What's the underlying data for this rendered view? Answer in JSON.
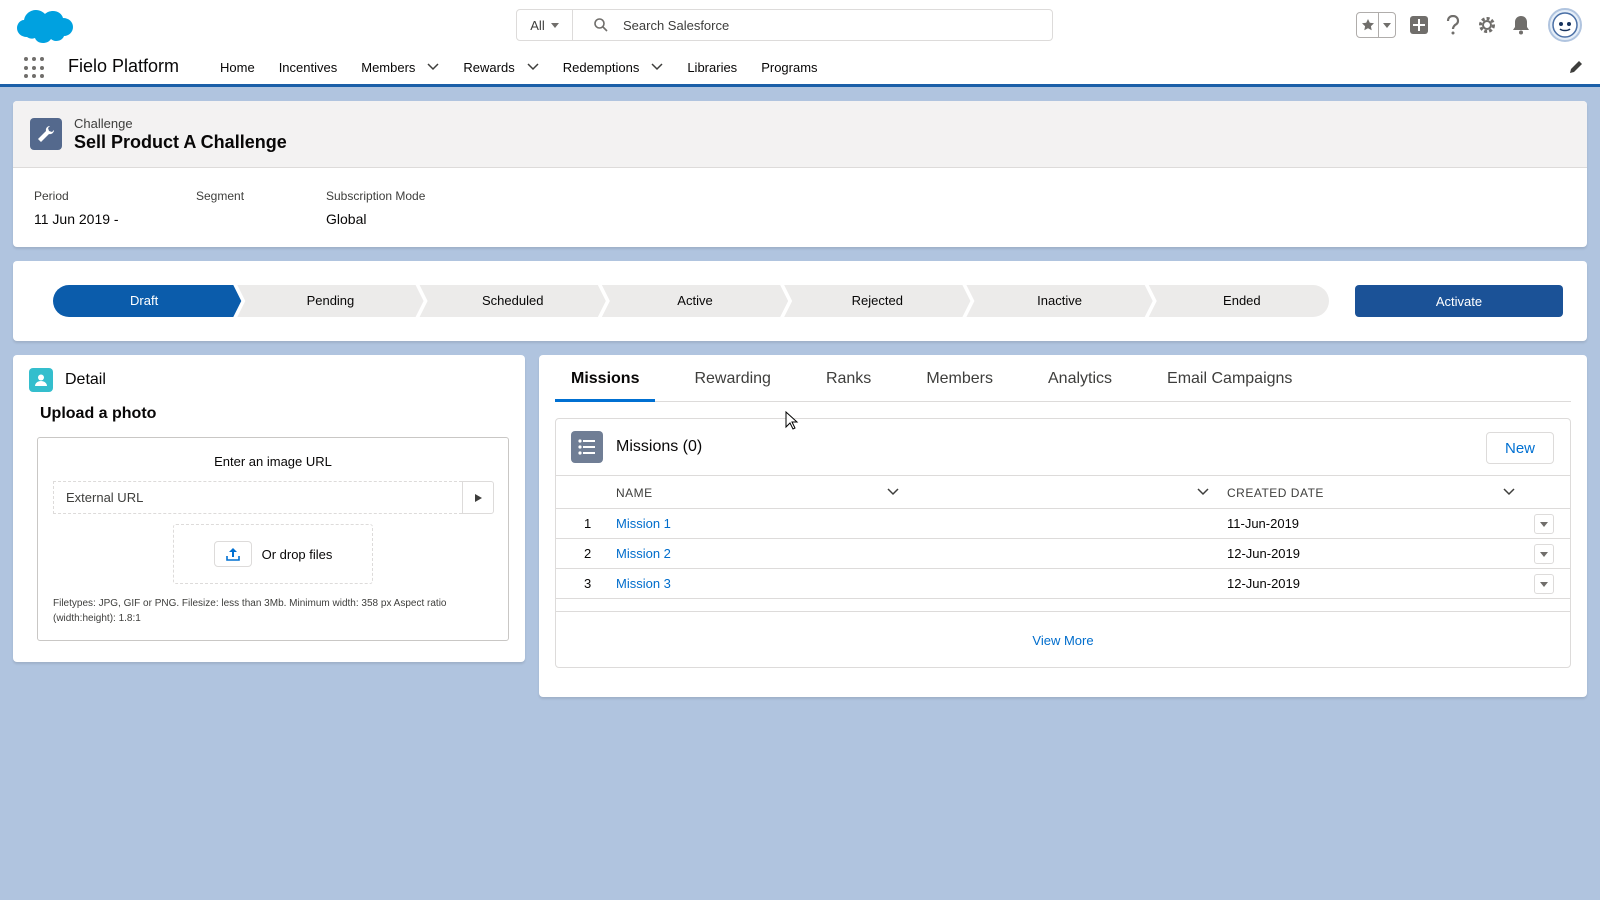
{
  "header": {
    "search_scope": "All",
    "search_placeholder": "Search Salesforce"
  },
  "nav": {
    "app_name": "Fielo Platform",
    "items": [
      {
        "label": "Home",
        "has_menu": false
      },
      {
        "label": "Incentives",
        "has_menu": false
      },
      {
        "label": "Members",
        "has_menu": true
      },
      {
        "label": "Rewards",
        "has_menu": true
      },
      {
        "label": "Redemptions",
        "has_menu": true
      },
      {
        "label": "Libraries",
        "has_menu": false
      },
      {
        "label": "Programs",
        "has_menu": false
      }
    ]
  },
  "record": {
    "type": "Challenge",
    "title": "Sell Product A Challenge",
    "fields": [
      {
        "label": "Period",
        "value": "11 Jun 2019 -"
      },
      {
        "label": "Segment",
        "value": ""
      },
      {
        "label": "Subscription Mode",
        "value": "Global"
      }
    ]
  },
  "path": {
    "stages": [
      "Draft",
      "Pending",
      "Scheduled",
      "Active",
      "Rejected",
      "Inactive",
      "Ended"
    ],
    "current_stage": "Draft",
    "action_label": "Activate"
  },
  "detail": {
    "title": "Detail",
    "upload_title": "Upload a photo",
    "enter_url_label": "Enter an image URL",
    "url_placeholder": "External URL",
    "drop_label": "Or drop files",
    "help_text": "Filetypes: JPG, GIF or PNG. Filesize: less than 3Mb. Minimum width: 358 px Aspect ratio (width:height): 1.8:1"
  },
  "tabs": {
    "items": [
      "Missions",
      "Rewarding",
      "Ranks",
      "Members",
      "Analytics",
      "Email Campaigns"
    ],
    "active": "Missions"
  },
  "missions": {
    "title": "Missions (0)",
    "new_label": "New",
    "columns": {
      "name": "NAME",
      "created_date": "CREATED DATE"
    },
    "rows": [
      {
        "num": "1",
        "name": "Mission 1",
        "created": "11-Jun-2019"
      },
      {
        "num": "2",
        "name": "Mission 2",
        "created": "12-Jun-2019"
      },
      {
        "num": "3",
        "name": "Mission 3",
        "created": "12-Jun-2019"
      }
    ],
    "view_more": "View More"
  },
  "colors": {
    "brand_blue": "#1b5297",
    "path_active": "#0b5cab",
    "link": "#006dcc",
    "page_bg": "#b0c4df"
  }
}
